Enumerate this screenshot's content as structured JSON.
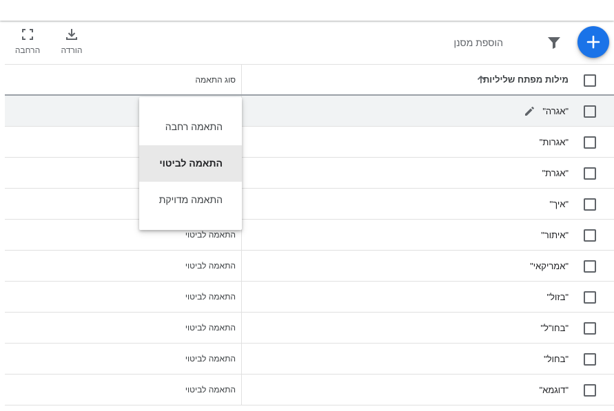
{
  "toolbar": {
    "add_filter_placeholder": "הוספת מסנן",
    "download_label": "הורדה",
    "expand_label": "הרחבה"
  },
  "table": {
    "header": {
      "keyword_col": "מילות מפתח שליליות",
      "match_col": "סוג התאמה"
    },
    "rows": [
      {
        "keyword": "\"אגרה\"",
        "match": ""
      },
      {
        "keyword": "\"אגרות\"",
        "match": ""
      },
      {
        "keyword": "\"אגרת\"",
        "match": ""
      },
      {
        "keyword": "\"איך\"",
        "match": ""
      },
      {
        "keyword": "\"איתור\"",
        "match": "התאמה לביטוי"
      },
      {
        "keyword": "\"אמריקאי\"",
        "match": "התאמה לביטוי"
      },
      {
        "keyword": "\"בזול\"",
        "match": "התאמה לביטוי"
      },
      {
        "keyword": "\"בחו\"ל\"",
        "match": "התאמה לביטוי"
      },
      {
        "keyword": "\"בחול\"",
        "match": "התאמה לביטוי"
      },
      {
        "keyword": "\"דוגמא\"",
        "match": "התאמה לביטוי"
      }
    ]
  },
  "match_menu": {
    "options": [
      "התאמה רחבה",
      "התאמה לביטוי",
      "התאמה מדויקת"
    ],
    "selected": "התאמה לביטוי"
  },
  "colors": {
    "accent": "#1a73e8",
    "row_highlight": "#f1f3f4",
    "menu_selected": "#e8e8e8"
  }
}
